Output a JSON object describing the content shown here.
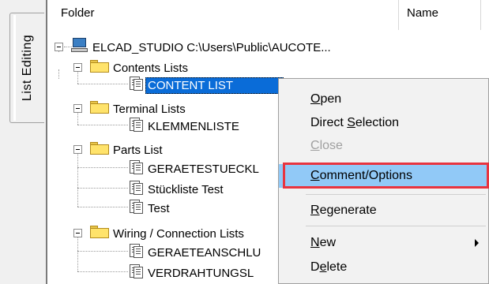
{
  "side_tab": {
    "label": "List Editing"
  },
  "header": {
    "col_folder": "Folder",
    "col_name": "Name"
  },
  "tree": {
    "root": "ELCAD_STUDIO C:\\Users\\Public\\AUCOTE...",
    "contents_lists": "Contents Lists",
    "content_list": "CONTENT LIST",
    "terminal_lists": "Terminal Lists",
    "klemmenliste": "KLEMMENLISTE",
    "parts_list": "Parts List",
    "geraetestueck": "GERAETESTUECKL",
    "stueckliste_test": "Stückliste Test",
    "test": "Test",
    "wiring_lists": "Wiring / Connection Lists",
    "geraeteanschlu": "GERAETEANSCHLU",
    "verdrahtungsl": "VERDRAHTUNGSL"
  },
  "context_menu": {
    "open": {
      "pre": "",
      "key": "O",
      "post": "pen"
    },
    "direct_selection": {
      "pre": "Direct ",
      "key": "S",
      "post": "election"
    },
    "close": {
      "pre": "",
      "key": "C",
      "post": "lose"
    },
    "comment_options": {
      "pre": "",
      "key": "C",
      "post": "omment/Options"
    },
    "regenerate": {
      "pre": "",
      "key": "R",
      "post": "egenerate"
    },
    "new": {
      "pre": "",
      "key": "N",
      "post": "ew"
    },
    "delete": {
      "pre": "D",
      "key": "e",
      "post": "lete"
    }
  },
  "colors": {
    "selection": "#0a6cd8",
    "menu_highlight": "#91c9f7",
    "callout_border": "#e8343f"
  }
}
